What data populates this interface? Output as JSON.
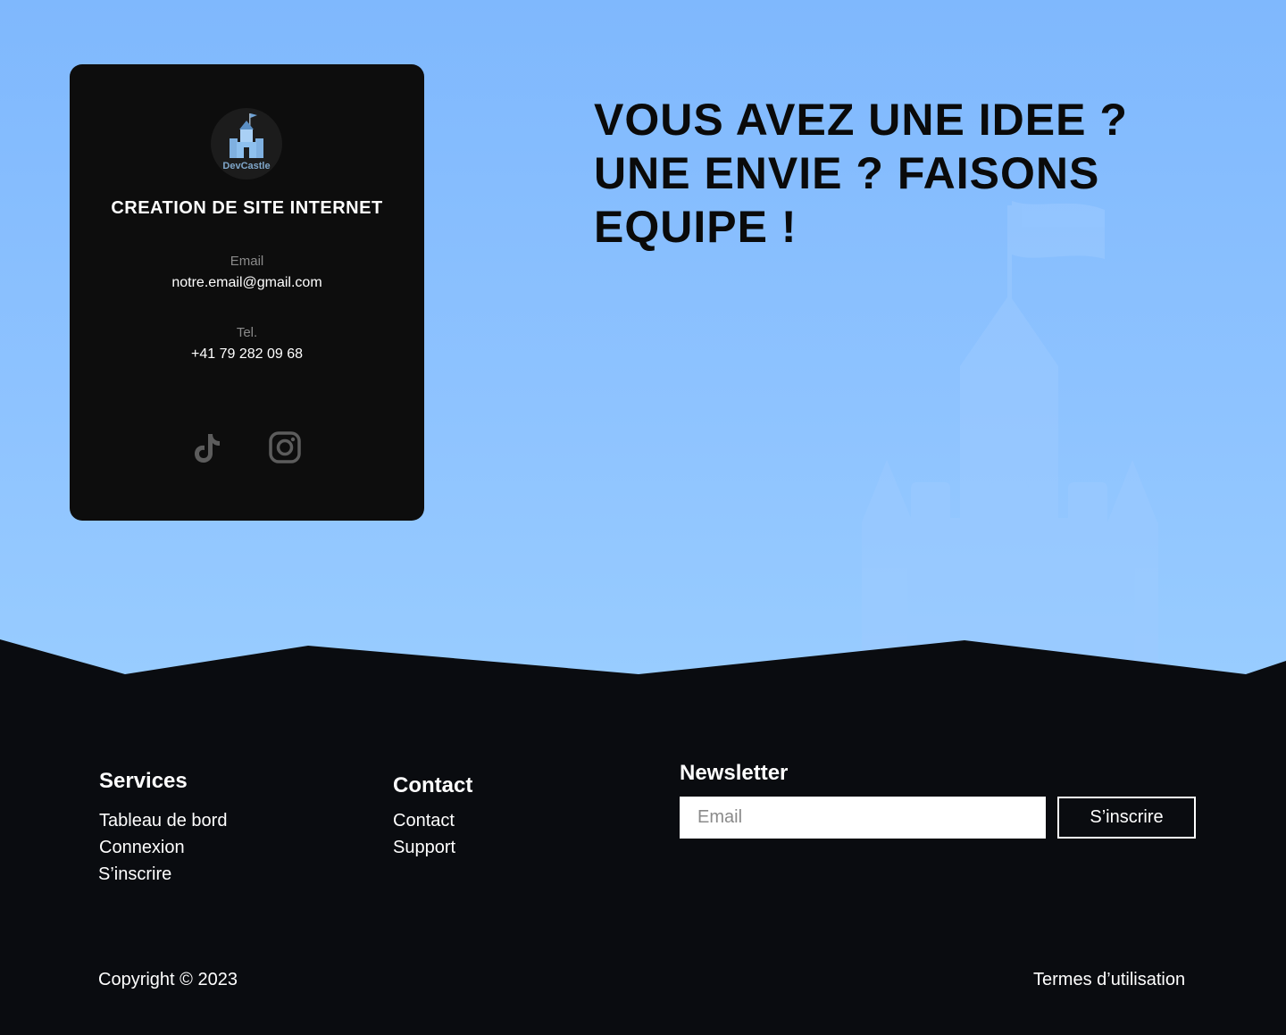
{
  "card": {
    "logo_text": "DevCastle",
    "title": "CREATION DE SITE INTERNET",
    "email_label": "Email",
    "email_value": "notre.email@gmail.com",
    "tel_label": "Tel.",
    "tel_value": "+41 79 282 09 68",
    "socials": [
      "tiktok-icon",
      "instagram-icon"
    ]
  },
  "hero": {
    "headline_line1": "VOUS AVEZ UNE IDEE ?",
    "headline_line2": "UNE ENVIE ? FAISONS",
    "headline_line3": "EQUIPE !"
  },
  "footer": {
    "services": {
      "title": "Services",
      "links": [
        "Tableau de bord",
        "Connexion",
        "S’inscrire"
      ]
    },
    "contact": {
      "title": "Contact",
      "links": [
        "Contact",
        "Support"
      ]
    },
    "newsletter": {
      "title": "Newsletter",
      "placeholder": "Email",
      "button": "S’inscrire"
    },
    "copyright": "Copyright © 2023",
    "terms": "Termes d’utilisation"
  },
  "colors": {
    "hero_bg": "#7fb8fd",
    "footer_bg": "#0a0c10",
    "card_bg": "#0d0d0d"
  }
}
